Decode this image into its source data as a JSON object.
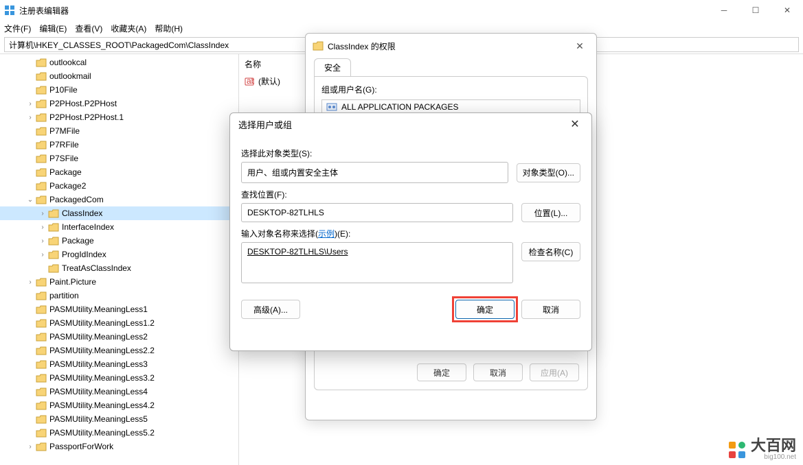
{
  "app": {
    "title": "注册表编辑器",
    "menus": [
      "文件(F)",
      "编辑(E)",
      "查看(V)",
      "收藏夹(A)",
      "帮助(H)"
    ],
    "address": "计算机\\HKEY_CLASSES_ROOT\\PackagedCom\\ClassIndex"
  },
  "tree": [
    {
      "label": "outlookcal",
      "indent": 2,
      "exp": ""
    },
    {
      "label": "outlookmail",
      "indent": 2,
      "exp": ""
    },
    {
      "label": "P10File",
      "indent": 2,
      "exp": ""
    },
    {
      "label": "P2PHost.P2PHost",
      "indent": 2,
      "exp": ">"
    },
    {
      "label": "P2PHost.P2PHost.1",
      "indent": 2,
      "exp": ">"
    },
    {
      "label": "P7MFile",
      "indent": 2,
      "exp": ""
    },
    {
      "label": "P7RFile",
      "indent": 2,
      "exp": ""
    },
    {
      "label": "P7SFile",
      "indent": 2,
      "exp": ""
    },
    {
      "label": "Package",
      "indent": 2,
      "exp": ""
    },
    {
      "label": "Package2",
      "indent": 2,
      "exp": ""
    },
    {
      "label": "PackagedCom",
      "indent": 2,
      "exp": "v"
    },
    {
      "label": "ClassIndex",
      "indent": 3,
      "exp": ">",
      "selected": true
    },
    {
      "label": "InterfaceIndex",
      "indent": 3,
      "exp": ">"
    },
    {
      "label": "Package",
      "indent": 3,
      "exp": ">"
    },
    {
      "label": "ProgIdIndex",
      "indent": 3,
      "exp": ">"
    },
    {
      "label": "TreatAsClassIndex",
      "indent": 3,
      "exp": ""
    },
    {
      "label": "Paint.Picture",
      "indent": 2,
      "exp": ">"
    },
    {
      "label": "partition",
      "indent": 2,
      "exp": ""
    },
    {
      "label": "PASMUtility.MeaningLess1",
      "indent": 2,
      "exp": ""
    },
    {
      "label": "PASMUtility.MeaningLess1.2",
      "indent": 2,
      "exp": ""
    },
    {
      "label": "PASMUtility.MeaningLess2",
      "indent": 2,
      "exp": ""
    },
    {
      "label": "PASMUtility.MeaningLess2.2",
      "indent": 2,
      "exp": ""
    },
    {
      "label": "PASMUtility.MeaningLess3",
      "indent": 2,
      "exp": ""
    },
    {
      "label": "PASMUtility.MeaningLess3.2",
      "indent": 2,
      "exp": ""
    },
    {
      "label": "PASMUtility.MeaningLess4",
      "indent": 2,
      "exp": ""
    },
    {
      "label": "PASMUtility.MeaningLess4.2",
      "indent": 2,
      "exp": ""
    },
    {
      "label": "PASMUtility.MeaningLess5",
      "indent": 2,
      "exp": ""
    },
    {
      "label": "PASMUtility.MeaningLess5.2",
      "indent": 2,
      "exp": ""
    },
    {
      "label": "PassportForWork",
      "indent": 2,
      "exp": ">"
    }
  ],
  "values": {
    "headers": {
      "name": "名称"
    },
    "default_label": "(默认)"
  },
  "perm_dialog": {
    "title": "ClassIndex 的权限",
    "tab": "安全",
    "group_label": "组或用户名(G):",
    "items": [
      "ALL APPLICATION PACKAGES"
    ],
    "buttons": {
      "ok": "确定",
      "cancel": "取消",
      "apply": "应用(A)"
    }
  },
  "sel_dialog": {
    "title": "选择用户或组",
    "obj_type_label": "选择此对象类型(S):",
    "obj_type_value": "用户、组或内置安全主体",
    "obj_type_btn": "对象类型(O)...",
    "location_label": "查找位置(F):",
    "location_value": "DESKTOP-82TLHLS",
    "location_btn": "位置(L)...",
    "name_label_prefix": "输入对象名称来选择(",
    "name_label_link": "示例",
    "name_label_suffix": ")(E):",
    "name_value": "DESKTOP-82TLHLS\\Users",
    "check_btn": "检查名称(C)",
    "advanced_btn": "高级(A)...",
    "ok": "确定",
    "cancel": "取消"
  },
  "watermark": {
    "brand": "大百网",
    "url": "big100.net"
  }
}
